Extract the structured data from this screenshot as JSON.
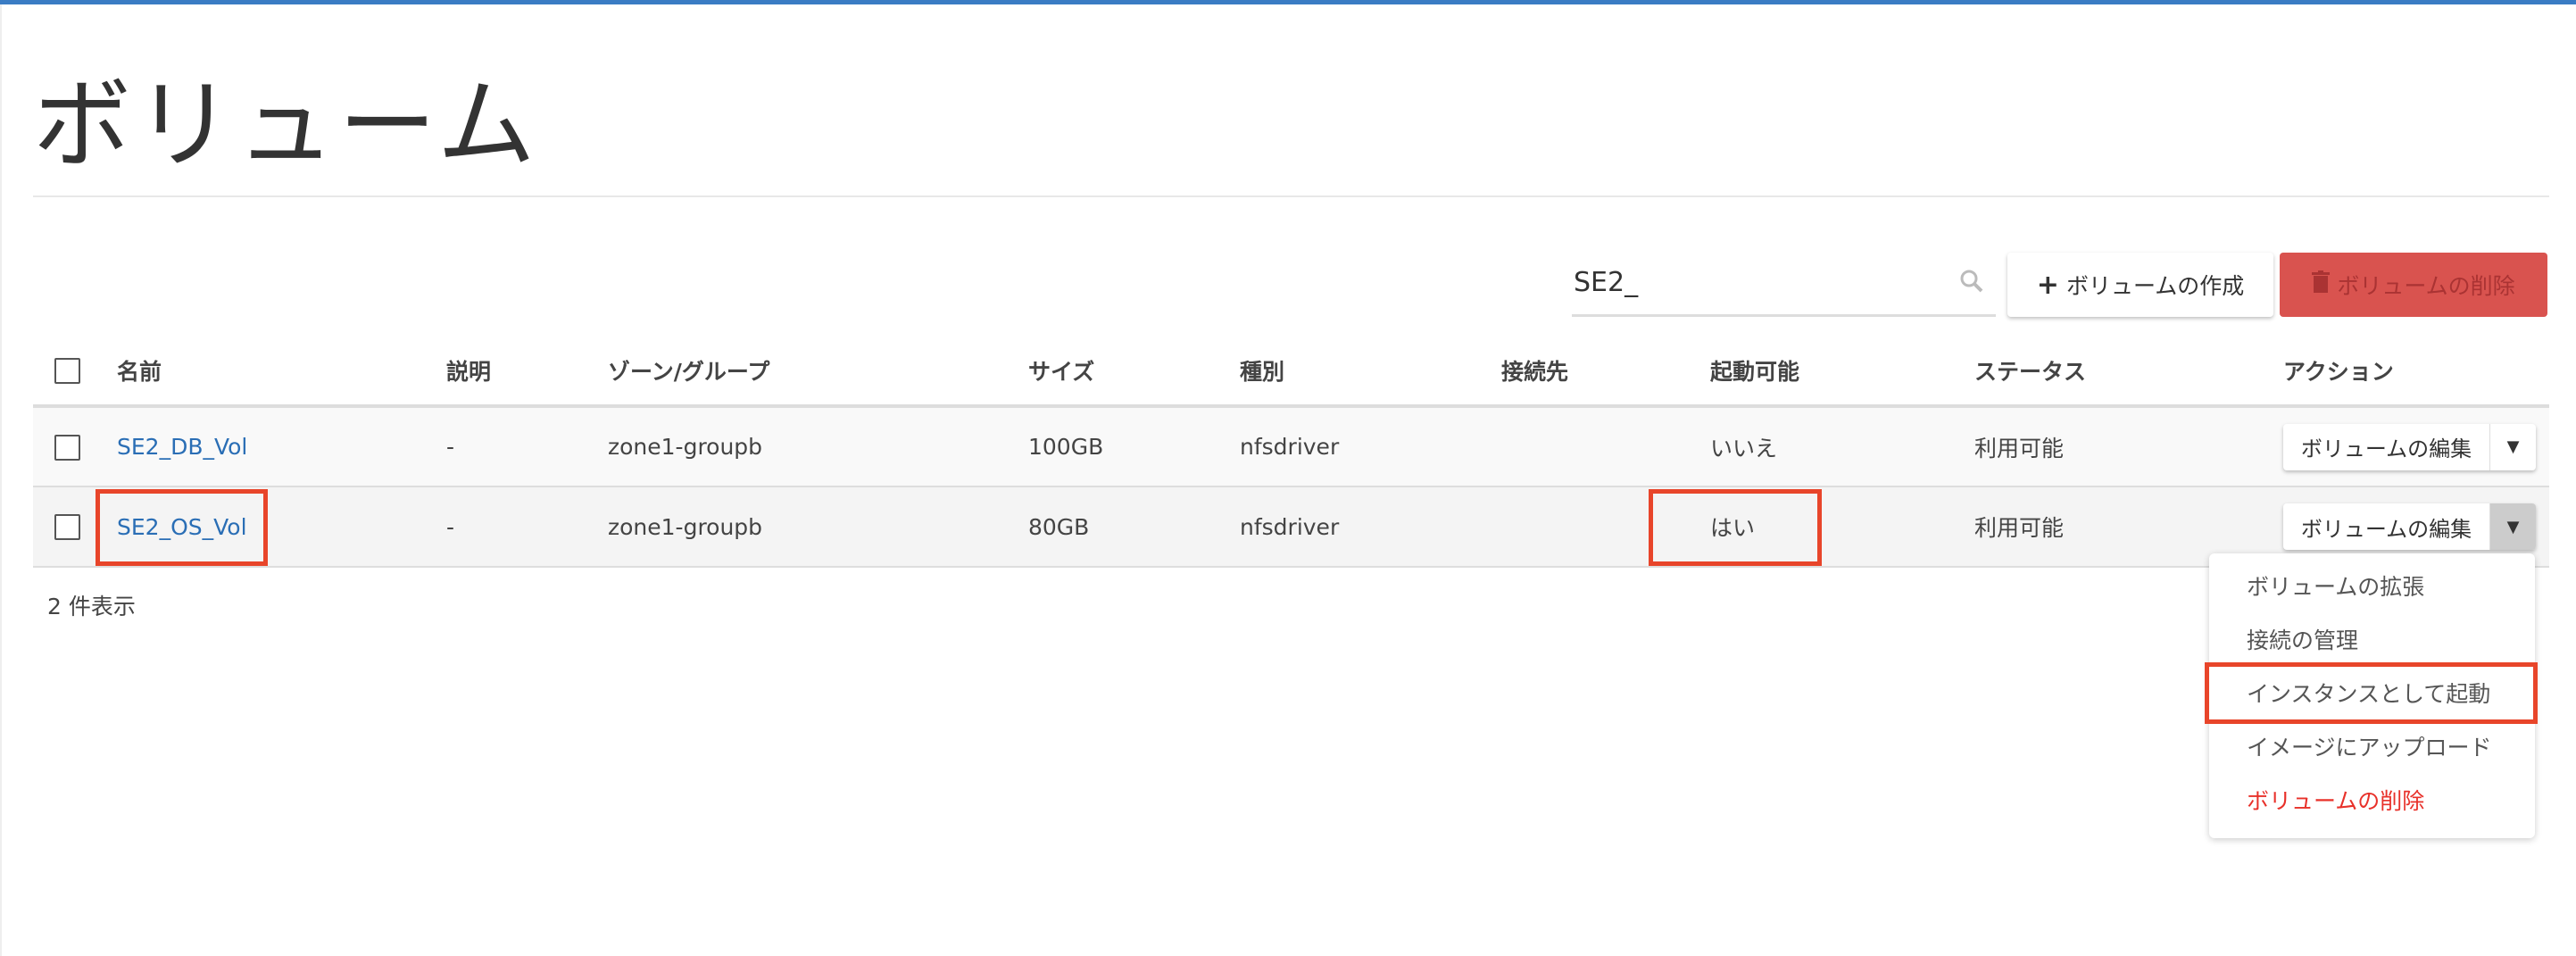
{
  "page": {
    "title": "ボリューム",
    "accent": "#3a7cc4"
  },
  "search": {
    "value": "SE2_"
  },
  "toolbar": {
    "create_label": "ボリュームの作成",
    "delete_label": "ボリュームの削除"
  },
  "table": {
    "headers": [
      "名前",
      "説明",
      "ゾーン/グループ",
      "サイズ",
      "種別",
      "接続先",
      "起動可能",
      "ステータス",
      "アクション"
    ],
    "rows": [
      {
        "name": "SE2_DB_Vol",
        "description": "-",
        "zone": "zone1-groupb",
        "size": "100GB",
        "type": "nfsdriver",
        "attached": "",
        "bootable": "いいえ",
        "status": "利用可能",
        "action": "ボリュームの編集"
      },
      {
        "name": "SE2_OS_Vol",
        "description": "-",
        "zone": "zone1-groupb",
        "size": "80GB",
        "type": "nfsdriver",
        "attached": "",
        "bootable": "はい",
        "status": "利用可能",
        "action": "ボリュームの編集"
      }
    ]
  },
  "footer": {
    "count": "2 件表示"
  },
  "menu": {
    "items": [
      "ボリュームの拡張",
      "接続の管理",
      "インスタンスとして起動",
      "イメージにアップロード",
      "ボリュームの削除"
    ]
  }
}
